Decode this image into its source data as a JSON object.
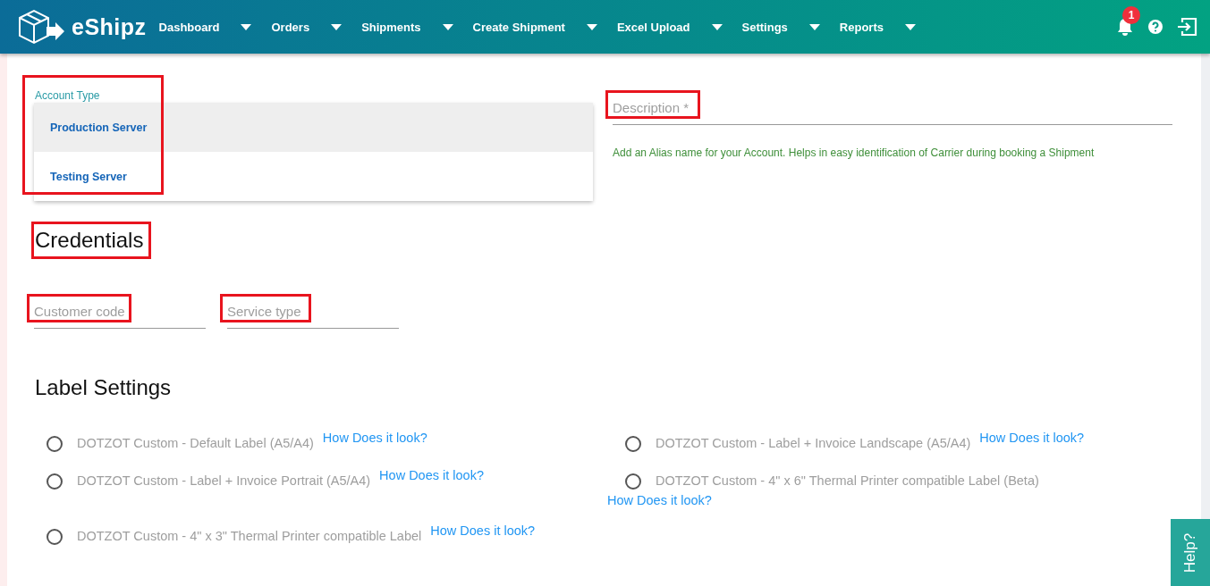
{
  "header": {
    "brand": "eShipz",
    "nav": [
      {
        "label": "Dashboard"
      },
      {
        "label": "Orders"
      },
      {
        "label": "Shipments"
      },
      {
        "label": "Create Shipment"
      },
      {
        "label": "Excel Upload"
      },
      {
        "label": "Settings"
      },
      {
        "label": "Reports"
      }
    ],
    "notification_count": "1"
  },
  "account_type": {
    "label": "Account Type",
    "highlighted": true,
    "options": [
      {
        "label": "Production Server",
        "selected": true
      },
      {
        "label": "Testing Server",
        "selected": false
      }
    ]
  },
  "description": {
    "placeholder": "Description *",
    "highlighted": true,
    "hint": "Add an Alias name for your Account. Helps in easy identification of Carrier during booking a Shipment"
  },
  "credentials": {
    "title": "Credentials",
    "highlighted": true,
    "fields": [
      {
        "placeholder": "Customer code",
        "highlighted": true
      },
      {
        "placeholder": "Service type",
        "highlighted": true
      }
    ]
  },
  "label_settings": {
    "title": "Label Settings",
    "options": [
      {
        "label": "DOTZOT Custom - Default Label (A5/A4)",
        "link": "How Does it look?",
        "selected": false
      },
      {
        "label": "DOTZOT Custom - Label + Invoice Landscape (A5/A4)",
        "link": "How Does it look?",
        "selected": false
      },
      {
        "label": "DOTZOT Custom - Label + Invoice Portrait (A5/A4)",
        "link": "How Does it look?",
        "selected": false
      },
      {
        "label": "DOTZOT Custom - 4\" x 6\" Thermal Printer compatible Label (Beta)",
        "link": "How Does it look?",
        "selected": false
      },
      {
        "label": "DOTZOT Custom - 4\" x 3\" Thermal Printer compatible Label",
        "link": "How Does it look?",
        "selected": false
      }
    ]
  },
  "help_tab": "Help?"
}
